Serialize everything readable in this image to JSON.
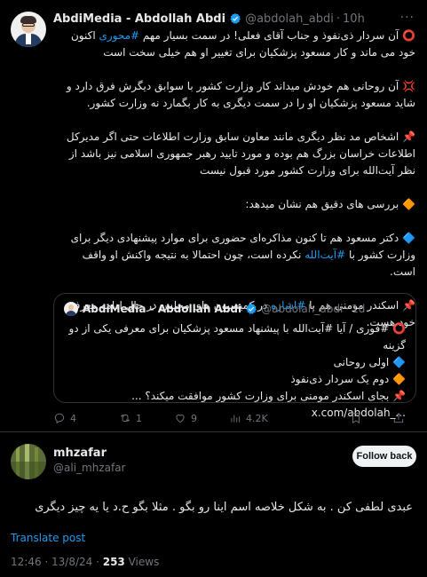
{
  "tweet": {
    "author_name": "AbdiMedia - Abdollah Abdi",
    "handle": "@abdolah_abdi",
    "time": "10h",
    "more": "···",
    "paragraphs": [
      [
        "⭕ آن سردار ذی‌نفوذ و جناب آقای فعلی! در سمت بسیار مهم ",
        {
          "tag": "#محوری"
        },
        " اکنون خود می ماند و کار مسعود پزشکیان برای تغییر او هم خیلی سخت است"
      ],
      [
        "💢 آن روحانی هم خودش میداند کار وزارت کشور با سوابق دیگرش فرق دارد و شاید مسعود پزشکیان او را در سمت دیگری به کار بگمارد نه وزارت کشور."
      ],
      [
        "📌 اشخاص مد نظر دیگری مانند معاون سابق وزارت اطلاعات حتی اگر مدیرکل اطلاعات خراسان بزرگ هم بوده و مورد تایید رهبر جمهوری اسلامی نیز باشد از نظر آیت‌الله برای وزارت کشور مورد قبول نیست"
      ],
      [
        "🔶 بررسی های دقیق هم نشان میدهد:"
      ],
      [
        "🔷 دکتر مسعود هم تا کنون مذاکره‌ای حضوری برای موارد پیشنهادی دیگر برای وزارت کشور با ",
        {
          "tag": "#آیت‌الله"
        },
        " نکرده است، چون احتمالا به نتیجه واکنش او واقف است."
      ],
      [
        "📌 اسکندر مومنی هم با ",
        {
          "tag": "#اشاره"
        },
        " در کمیسیون های مجلس در حال ادامه معرفی خود هست."
      ]
    ]
  },
  "quote": {
    "author_name": "AbdiMedia - Abdollah Abdi",
    "handle": "@abdolah_abdi",
    "time": "1d",
    "lines": [
      "⭕ #فوری / آیا #آیت‌الله با پیشنهاد مسعود پزشکیان برای معرفی یکی از دو گزینه",
      "🔷 اولی روحانی",
      "🔶 دوم یک سردار ذی‌نفوذ",
      "📌 بجای اسکندر مومنی برای وزارت کشور موافقت میکند؟ ..."
    ],
    "link": "x.com/abdolah_..."
  },
  "actions": {
    "replies": "4",
    "retweets": "1",
    "likes": "9",
    "views": "4.2K"
  },
  "reply": {
    "author_name": "mhzafar",
    "handle": "@ali_mhzafar",
    "follow_label": "Follow back",
    "text": "عبدی لطفی کن . به شکل خلاصه اسم اینا رو بگو . مثلا بگو ح.د یا یه چیز دیگری",
    "translate_label": "Translate post",
    "timestamp": "12:46 · 13/8/24 · ",
    "views_count": "253",
    "views_label": " Views"
  },
  "colors": {
    "background": "#000000",
    "text": "#e7e9ea",
    "muted": "#71767b",
    "accent": "#1d9bf0",
    "border": "#2f3336"
  },
  "icons": [
    "verified-badge-icon",
    "reply-icon",
    "retweet-icon",
    "like-icon",
    "views-icon",
    "bookmark-icon",
    "share-icon"
  ]
}
